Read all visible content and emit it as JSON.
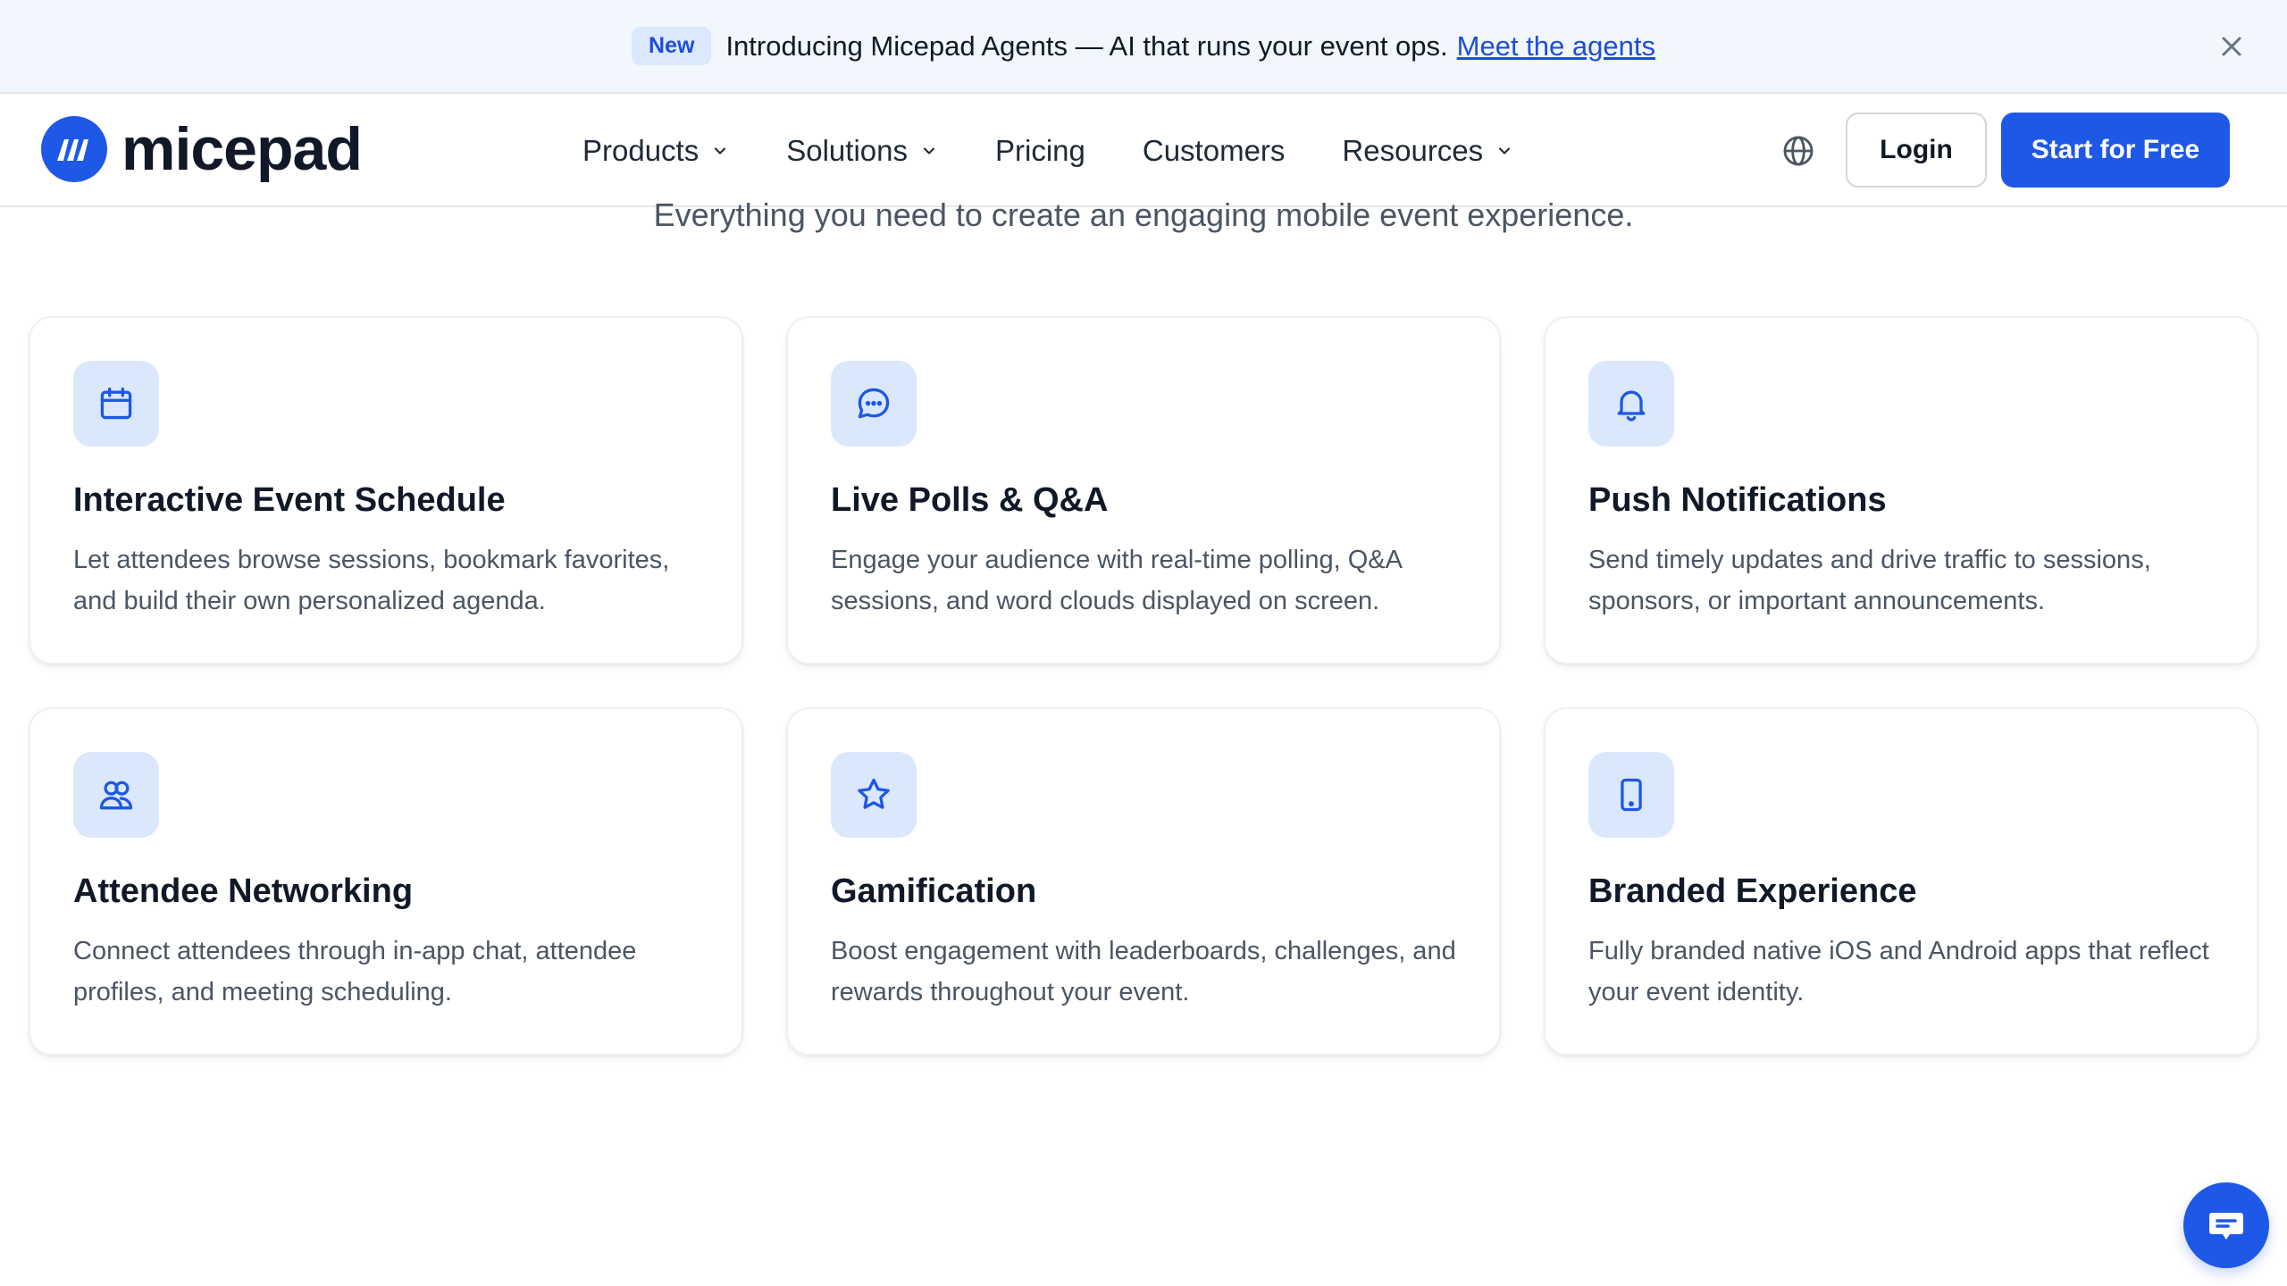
{
  "announcement": {
    "badge": "New",
    "text": "Introducing Micepad Agents — AI that runs your event ops.",
    "link": "Meet the agents"
  },
  "header": {
    "logo_text": "micepad",
    "nav": [
      {
        "label": "Products",
        "has_dropdown": true
      },
      {
        "label": "Solutions",
        "has_dropdown": true
      },
      {
        "label": "Pricing",
        "has_dropdown": false
      },
      {
        "label": "Customers",
        "has_dropdown": false
      },
      {
        "label": "Resources",
        "has_dropdown": true
      }
    ],
    "login_label": "Login",
    "cta_label": "Start for Free"
  },
  "section": {
    "subtitle": "Everything you need to create an engaging mobile event experience."
  },
  "features": [
    {
      "icon": "calendar-icon",
      "title": "Interactive Event Schedule",
      "description": "Let attendees browse sessions, bookmark favorites, and build their own personalized agenda."
    },
    {
      "icon": "chat-icon",
      "title": "Live Polls & Q&A",
      "description": "Engage your audience with real-time polling, Q&A sessions, and word clouds displayed on screen."
    },
    {
      "icon": "bell-icon",
      "title": "Push Notifications",
      "description": "Send timely updates and drive traffic to sessions, sponsors, or important announcements."
    },
    {
      "icon": "users-icon",
      "title": "Attendee Networking",
      "description": "Connect attendees through in-app chat, attendee profiles, and meeting scheduling."
    },
    {
      "icon": "star-icon",
      "title": "Gamification",
      "description": "Boost engagement with leaderboards, challenges, and rewards throughout your event."
    },
    {
      "icon": "smartphone-icon",
      "title": "Branded Experience",
      "description": "Fully branded native iOS and Android apps that reflect your event identity."
    }
  ],
  "colors": {
    "brand": "#1e58e6",
    "icon_bg": "#dbe8fc",
    "announce_bg": "#f2f6fd"
  }
}
